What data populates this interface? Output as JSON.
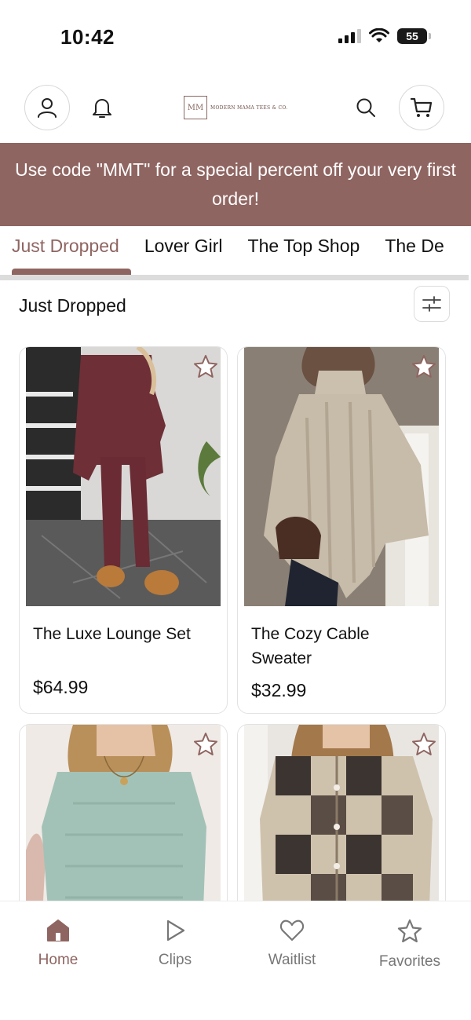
{
  "status_bar": {
    "time": "10:42",
    "battery": "55"
  },
  "header": {
    "logo_mark": "MM",
    "logo_text": "MODERN MAMA TEES & CO."
  },
  "banner": {
    "text": "Use code \"MMT\" for a special percent off your very first order!"
  },
  "tabs": [
    {
      "label": "Just Dropped",
      "active": true
    },
    {
      "label": "Lover Girl",
      "active": false
    },
    {
      "label": "The Top Shop",
      "active": false
    },
    {
      "label": "The De",
      "active": false
    }
  ],
  "section": {
    "title": "Just Dropped"
  },
  "products": [
    {
      "name": "The Luxe Lounge Set",
      "price": "$64.99",
      "favorited": false
    },
    {
      "name": "The Cozy Cable Sweater",
      "price": "$32.99",
      "favorited": false
    },
    {
      "name": "",
      "price": "",
      "favorited": false
    },
    {
      "name": "",
      "price": "",
      "favorited": false
    }
  ],
  "bottom_nav": [
    {
      "label": "Home",
      "icon": "home-icon",
      "active": true
    },
    {
      "label": "Clips",
      "icon": "play-icon",
      "active": false
    },
    {
      "label": "Waitlist",
      "icon": "heart-icon",
      "active": false
    },
    {
      "label": "Favorites",
      "icon": "star-icon",
      "active": false
    }
  ],
  "colors": {
    "accent": "#8f6561",
    "inactive": "#777777"
  }
}
